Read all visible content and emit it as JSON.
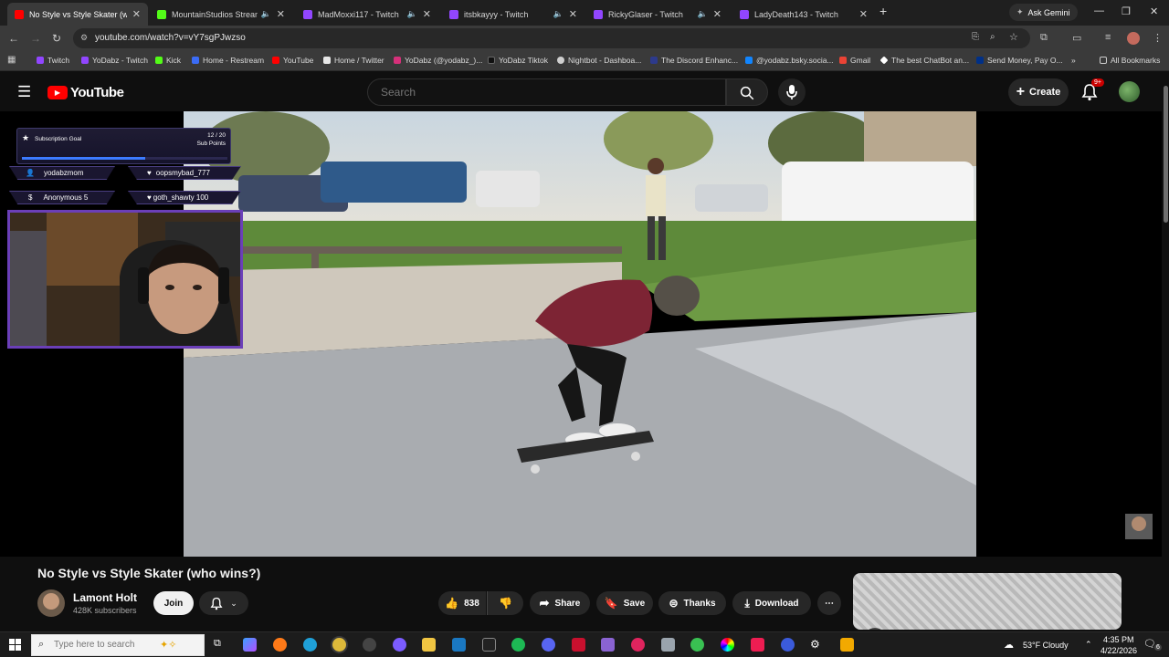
{
  "browser": {
    "tabs": [
      {
        "title": "No Style vs Style Skater (w",
        "color": "#ff0000",
        "active": true
      },
      {
        "title": "MountainStudios Stream -",
        "color": "#53fc18",
        "active": false
      },
      {
        "title": "MadMoxxi117 - Twitch",
        "color": "#9146ff",
        "active": false
      },
      {
        "title": "itsbkayyy - Twitch",
        "color": "#9146ff",
        "active": false
      },
      {
        "title": "RickyGlaser - Twitch",
        "color": "#9146ff",
        "active": false
      },
      {
        "title": "LadyDeath143 - Twitch",
        "color": "#9146ff",
        "active": false
      }
    ],
    "ask_gemini": "Ask Gemini",
    "url": "youtube.com/watch?v=vY7sgPJwzso",
    "bookmarks": [
      {
        "label": "Twitch",
        "color": "#9146ff"
      },
      {
        "label": "YoDabz - Twitch",
        "color": "#9146ff"
      },
      {
        "label": "Kick",
        "color": "#53fc18"
      },
      {
        "label": "Home - Restream",
        "color": "#3b6cf6"
      },
      {
        "label": "YouTube",
        "color": "#ff0000"
      },
      {
        "label": "Home / Twitter",
        "color": "#e7e7e7"
      },
      {
        "label": "YoDabz (@yodabz_)...",
        "color": "#d6307a"
      },
      {
        "label": "YoDabz Tiktok",
        "color": "#111111"
      },
      {
        "label": "Nightbot - Dashboa...",
        "color": "#cfcfcf"
      },
      {
        "label": "The Discord Enhanc...",
        "color": "#2d3a8c"
      },
      {
        "label": "@yodabz.bsky.socia...",
        "color": "#1185fe"
      },
      {
        "label": "Gmail",
        "color": "#ea4335"
      },
      {
        "label": "The best ChatBot an...",
        "color": "#ffffff"
      },
      {
        "label": "Send Money, Pay O...",
        "color": "#003087"
      }
    ],
    "all_bookmarks": "All Bookmarks"
  },
  "youtube": {
    "logo_text": "YouTube",
    "search_placeholder": "Search",
    "create_label": "Create",
    "notif_badge": "9+"
  },
  "overlay": {
    "goal_label": "Subscription Goal",
    "goal_count": "12 / 20",
    "goal_unit": "Sub Points",
    "goal_progress": 0.6,
    "alerts": [
      {
        "icon": "user-icon",
        "text": "yodabzmom"
      },
      {
        "icon": "heart-icon",
        "text": "oopsmybad_777"
      },
      {
        "icon": "dollar-icon",
        "text": "Anonymous 5"
      },
      {
        "icon": "heart-icon",
        "text": "goth_shawty 100"
      }
    ]
  },
  "video": {
    "title": "No Style vs Style Skater (who wins?)",
    "channel": "Lamont Holt",
    "subscribers": "428K subscribers",
    "join_label": "Join",
    "likes": "838",
    "share_label": "Share",
    "save_label": "Save",
    "thanks_label": "Thanks",
    "download_label": "Download"
  },
  "taskbar": {
    "search_placeholder": "Type here to search",
    "weather": "53°F  Cloudy",
    "time": "4:35 PM",
    "date": "4/22/2026",
    "notif_count": "6"
  }
}
